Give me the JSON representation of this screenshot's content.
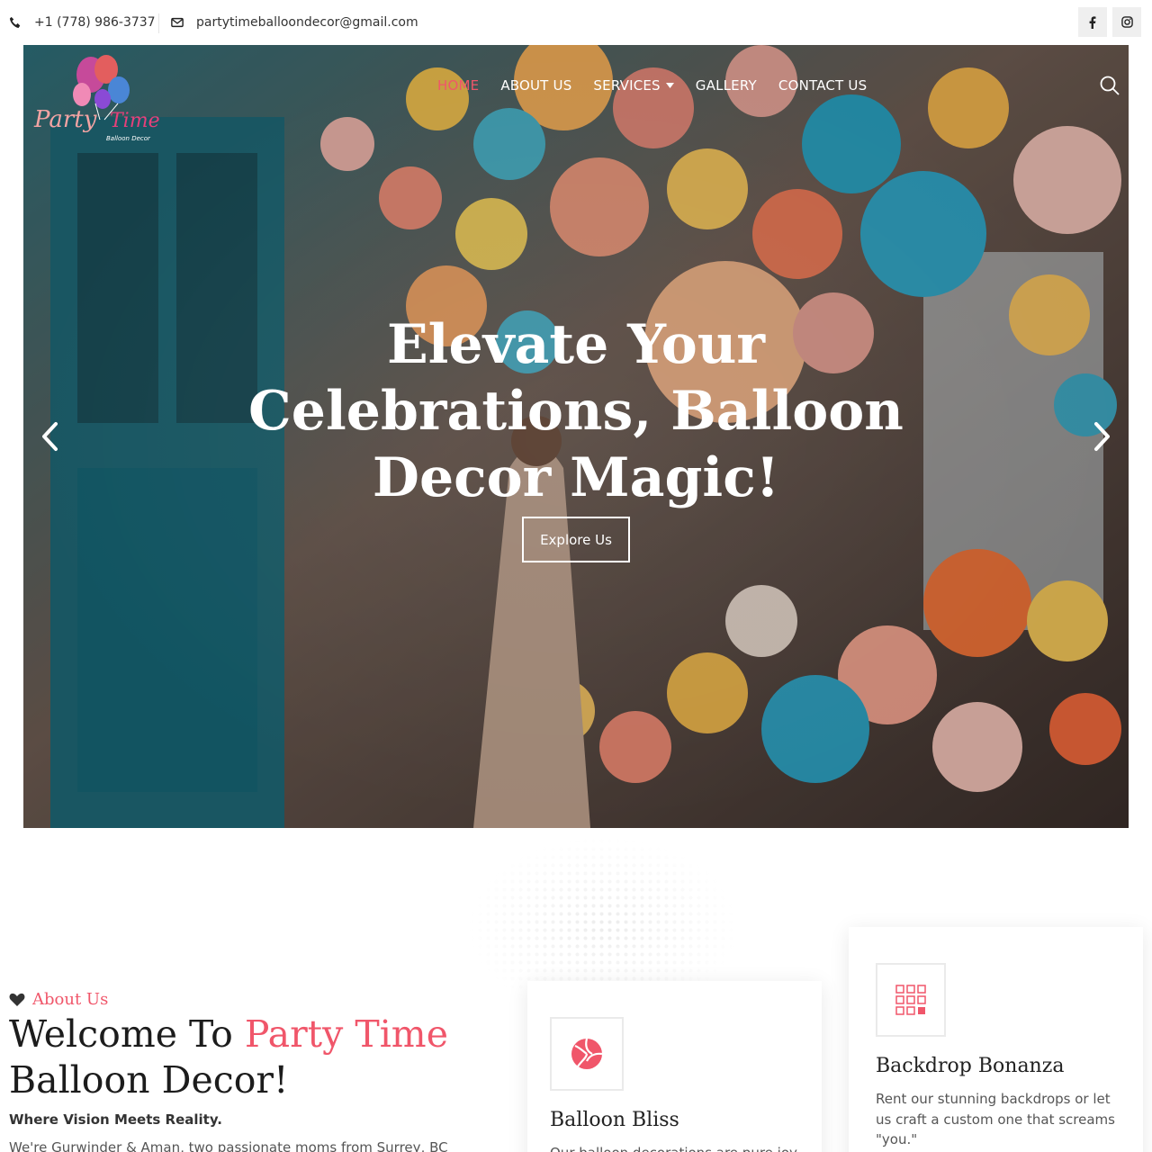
{
  "topbar": {
    "phone": "+1 (778) 986-3737",
    "email": "partytimeballoondecor@gmail.com",
    "social": [
      "facebook-icon",
      "instagram-icon"
    ]
  },
  "logo": {
    "line1": "Party",
    "line2": "Time",
    "tagline": "Balloon Decor"
  },
  "nav": {
    "items": [
      {
        "label": "HOME",
        "active": true
      },
      {
        "label": "ABOUT US"
      },
      {
        "label": "SERVICES",
        "has_dropdown": true
      },
      {
        "label": "GALLERY"
      },
      {
        "label": "CONTACT US"
      }
    ]
  },
  "hero": {
    "title_lines": [
      "Elevate Your",
      "Celebrations, Balloon",
      "Decor Magic!"
    ],
    "cta": "Explore Us"
  },
  "about": {
    "eyebrow": "About Us",
    "title_part1": "Welcome To ",
    "title_accent": "Party Time",
    "title_part2": "Balloon Decor!",
    "subtitle": "Where Vision Meets Reality.",
    "text": "We're Gurwinder & Aman, two passionate moms from Surrey, BC"
  },
  "services": [
    {
      "title": "Balloon Bliss",
      "text": "Our balloon decorations are pure joy",
      "icon": "volleyball-icon"
    },
    {
      "title": "Backdrop Bonanza",
      "text": "Rent our stunning backdrops or let us craft a custom one that screams \"you.\"",
      "icon": "grid-icon"
    }
  ],
  "colors": {
    "accent": "#f0566a",
    "text": "#222222"
  }
}
